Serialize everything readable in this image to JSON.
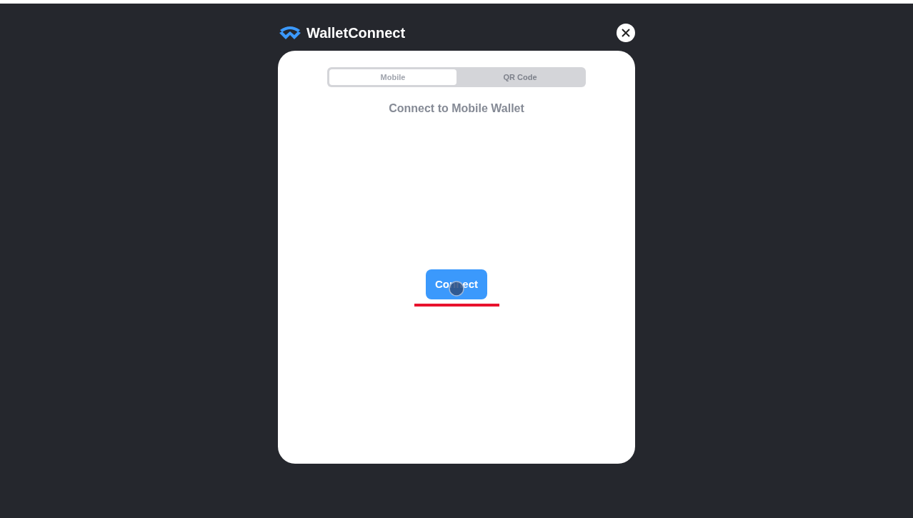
{
  "header": {
    "title": "WalletConnect"
  },
  "tabs": [
    {
      "label": "Mobile",
      "selected": true
    },
    {
      "label": "QR Code",
      "selected": false
    }
  ],
  "heading": "Connect to Mobile Wallet",
  "buttons": [
    "Connect"
  ]
}
